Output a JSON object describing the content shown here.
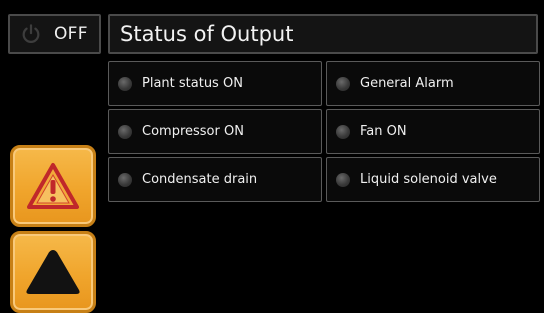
{
  "power": {
    "label": "OFF",
    "icon": "power-icon"
  },
  "header": {
    "title": "Status of Output"
  },
  "outputs": [
    {
      "label": "Plant status ON",
      "state": "off"
    },
    {
      "label": "General Alarm",
      "state": "off"
    },
    {
      "label": "Compressor ON",
      "state": "off"
    },
    {
      "label": "Fan ON",
      "state": "off"
    },
    {
      "label": "Condensate drain",
      "state": "off"
    },
    {
      "label": "Liquid solenoid valve",
      "state": "off"
    }
  ],
  "sidebar": {
    "alarm_button": {
      "icon": "warning-icon"
    },
    "up_button": {
      "icon": "triangle-up-icon"
    }
  },
  "colors": {
    "accent": "#f0a52c",
    "background": "#000000",
    "led_off": "#3a3a3a",
    "warning_red": "#c0282a"
  }
}
